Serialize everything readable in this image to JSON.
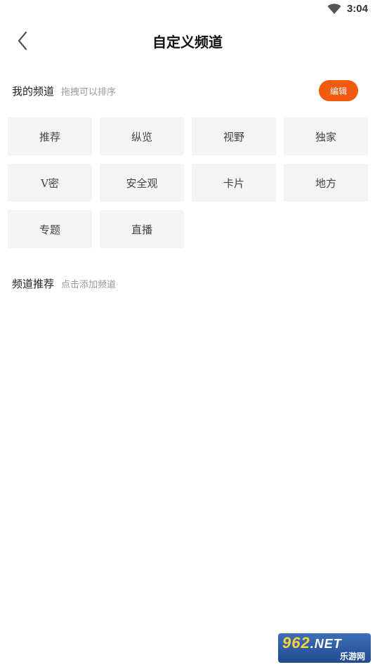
{
  "status_bar": {
    "time": "3:04",
    "wifi_icon": "wifi-icon"
  },
  "header": {
    "back_icon": "chevron-left-icon",
    "title": "自定义频道"
  },
  "my_channels": {
    "title": "我的频道",
    "hint": "拖拽可以排序",
    "edit_label": "编辑",
    "edit_color": "#f15a0f",
    "items": [
      {
        "label": "推荐"
      },
      {
        "label": "纵览"
      },
      {
        "label": "视野"
      },
      {
        "label": "独家"
      },
      {
        "label": "V密"
      },
      {
        "label": "安全观"
      },
      {
        "label": "卡片"
      },
      {
        "label": "地方"
      },
      {
        "label": "专题"
      },
      {
        "label": "直播"
      }
    ]
  },
  "recommended_channels": {
    "title": "频道推荐",
    "hint": "点击添加频道",
    "items": []
  },
  "watermark": {
    "brand": "962",
    "suffix": ".NET",
    "subtitle": "乐游网"
  }
}
